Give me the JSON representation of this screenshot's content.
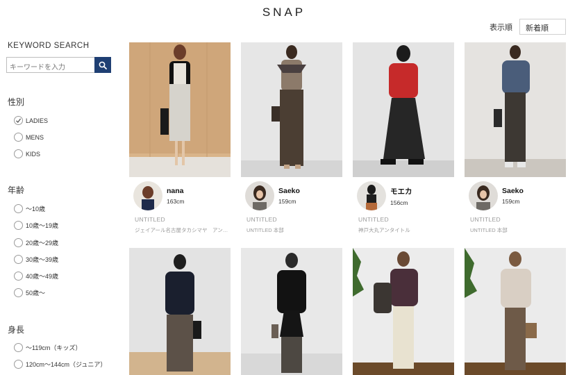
{
  "logo": "SNAP",
  "sort": {
    "label": "表示順",
    "value": "新着順"
  },
  "sidebar": {
    "keyword_title": "KEYWORD SEARCH",
    "keyword_placeholder": "キーワードを入力",
    "gender": {
      "title": "性別",
      "options": [
        "LADIES",
        "MENS",
        "KIDS"
      ],
      "checked": "LADIES"
    },
    "age": {
      "title": "年齢",
      "options": [
        "～10歳",
        "10歳～19歳",
        "20歳～29歳",
        "30歳～39歳",
        "40歳～49歳",
        "50歳～"
      ]
    },
    "height": {
      "title": "身長",
      "options": [
        "～119cm（キッズ）",
        "120cm～144cm（ジュニア）"
      ]
    }
  },
  "snaps": [
    {
      "name": "nana",
      "height": "163cm",
      "brand": "UNTITLED",
      "store": "ジェイアール名古屋タカシマヤ　アン…"
    },
    {
      "name": "Saeko",
      "height": "159cm",
      "brand": "UNTITLED",
      "store": "UNTITLED 本部"
    },
    {
      "name": "モエカ",
      "height": "156cm",
      "brand": "UNTITLED",
      "store": "神戸大丸アンタイトル"
    },
    {
      "name": "Saeko",
      "height": "159cm",
      "brand": "UNTITLED",
      "store": "UNTITLED 本部"
    }
  ],
  "colors": {
    "accent": "#1f3f73"
  }
}
